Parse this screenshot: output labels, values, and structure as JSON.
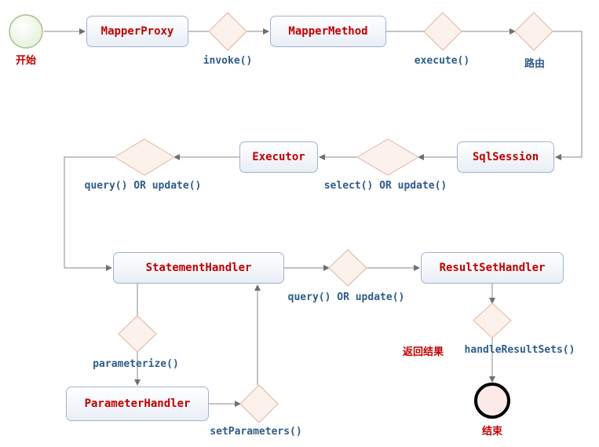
{
  "nodes": {
    "start": "开始",
    "end": "结束",
    "mapper_proxy": "MapperProxy",
    "mapper_method": "MapperMethod",
    "sql_session": "SqlSession",
    "executor": "Executor",
    "statement_handler": "StatementHandler",
    "result_set_handler": "ResultSetHandler",
    "parameter_handler": "ParameterHandler"
  },
  "edge_labels": {
    "invoke": "invoke()",
    "execute": "execute()",
    "route": "路由",
    "select_or_update": "select() OR update()",
    "query_or_update_1": "query() OR update()",
    "query_or_update_2": "query() OR update()",
    "parameterize": "parameterize()",
    "set_parameters": "setParameters()",
    "return_result": "返回结果",
    "handle_result_sets": "handleResultSets()"
  },
  "colors": {
    "node_text": "#c00000",
    "edge_text": "#2e5c8a",
    "diamond_fill": "#fdf1ec",
    "diamond_stroke": "#e0b0a0",
    "arrow": "#7f7f7f"
  }
}
